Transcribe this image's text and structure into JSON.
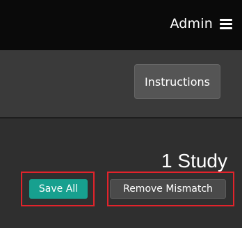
{
  "header": {
    "user_label": "Admin",
    "menu_icon": "hamburger-menu-icon"
  },
  "toolbar": {
    "instructions_label": "Instructions"
  },
  "study_panel": {
    "count_label": "1 Study",
    "save_all_label": "Save All",
    "remove_mismatch_label": "Remove Mismatch"
  },
  "colors": {
    "topbar_bg": "#0a0a0a",
    "toolbar_bg": "#3a3a3a",
    "panel_bg": "#2f2f2f",
    "save_all_bg": "#17a08f",
    "highlight_border": "#e2232b"
  }
}
